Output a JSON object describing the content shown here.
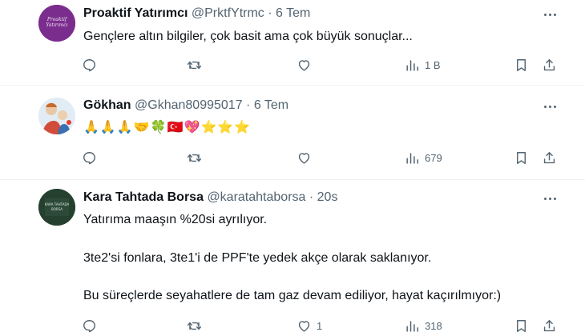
{
  "tweets": [
    {
      "name": "Proaktif Yatırımcı",
      "handle": "@PrktfYtrmc",
      "dot": "·",
      "time": "6 Tem",
      "avatar_text_1": "Proaktif",
      "avatar_text_2": "Yatırımcı",
      "lines": [
        "Gençlere altın bilgiler, çok basit ama çok büyük sonuçlar..."
      ],
      "views": "1 B",
      "likes": ""
    },
    {
      "name": "Gökhan",
      "handle": "@Gkhan80995017",
      "dot": "·",
      "time": "6 Tem",
      "lines": [
        "🙏🙏🙏🤝🍀🇹🇷💖⭐⭐⭐"
      ],
      "views": "679",
      "likes": ""
    },
    {
      "name": "Kara Tahtada Borsa",
      "handle": "@karatahtaborsa",
      "dot": "·",
      "time": "20s",
      "avatar_text_1": "KARA TAHTADA",
      "avatar_text_2": "BORSA",
      "lines": [
        "Yatırıma maaşın %20si ayrılıyor.",
        "3te2'si fonlara, 3te1'i de PPF'te yedek akçe olarak saklanıyor.",
        "Bu süreçlerde seyahatlere de tam gaz devam ediliyor, hayat kaçırılmıyor:)"
      ],
      "views": "318",
      "likes": "1"
    }
  ],
  "icons": [
    "reply-icon",
    "retweet-icon",
    "like-icon",
    "views-icon",
    "bookmark-icon",
    "share-icon",
    "more-icon"
  ],
  "colors": {
    "text": "#0f1419",
    "secondary": "#536471",
    "divider": "#eff3f4"
  }
}
